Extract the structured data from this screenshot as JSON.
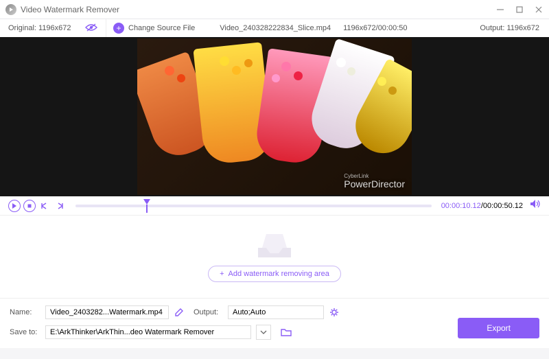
{
  "app": {
    "title": "Video Watermark Remover"
  },
  "info": {
    "original": "Original: 1196x672",
    "change_label": "Change Source File",
    "filename": "Video_240328222834_Slice.mp4",
    "dims_time": "1196x672/00:00:50",
    "output": "Output: 1196x672"
  },
  "preview": {
    "watermark_brand": "PowerDirector",
    "watermark_sub": "CyberLink"
  },
  "playback": {
    "current": "00:00:10.12",
    "total": "00:00:50.12"
  },
  "drop": {
    "add_label": "Add watermark removing area"
  },
  "form": {
    "name_label": "Name:",
    "name_value": "Video_2403282...Watermark.mp4",
    "output_label": "Output:",
    "output_value": "Auto;Auto",
    "save_label": "Save to:",
    "save_value": "E:\\ArkThinker\\ArkThin...deo Watermark Remover",
    "export_label": "Export"
  }
}
